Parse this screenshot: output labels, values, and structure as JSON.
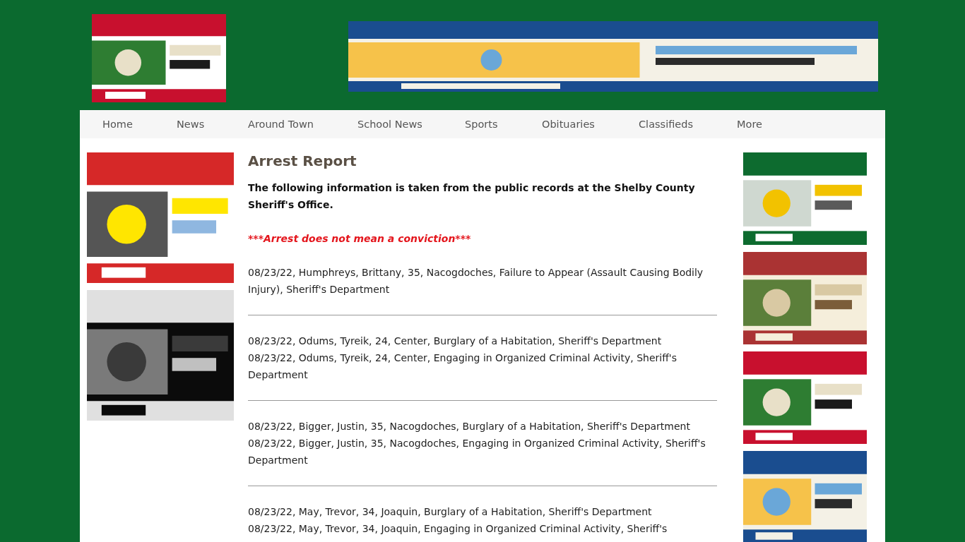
{
  "nav": [
    {
      "label": "Home"
    },
    {
      "label": "News"
    },
    {
      "label": "Around Town"
    },
    {
      "label": "School News"
    },
    {
      "label": "Sports"
    },
    {
      "label": "Obituaries"
    },
    {
      "label": "Classifieds"
    },
    {
      "label": "More"
    }
  ],
  "article": {
    "title": "Arrest Report",
    "intro": "The following information is taken from the public records at the Shelby County Sheriff's Office.",
    "notice": "***Arrest does not mean a conviction***",
    "entries": [
      {
        "lines": [
          "08/23/22, Humphreys, Brittany, 35, Nacogdoches, Failure to Appear (Assault Causing Bodily Injury), Sheriff's Department"
        ]
      },
      {
        "lines": [
          "08/23/22, Odums, Tyreik, 24, Center, Burglary of a Habitation, Sheriff's Department",
          "08/23/22, Odums, Tyreik, 24, Center, Engaging in Organized Criminal Activity, Sheriff's Department"
        ]
      },
      {
        "lines": [
          "08/23/22, Bigger, Justin, 35, Nacogdoches, Burglary of a Habitation, Sheriff's Department",
          "08/23/22, Bigger, Justin, 35, Nacogdoches, Engaging in Organized Criminal Activity, Sheriff's Department"
        ]
      },
      {
        "lines": [
          "08/23/22, May, Trevor, 34, Joaquin, Burglary of a Habitation, Sheriff's Department",
          "08/23/22, May, Trevor, 34, Joaquin, Engaging in Organized Criminal Activity, Sheriff's"
        ]
      }
    ]
  }
}
